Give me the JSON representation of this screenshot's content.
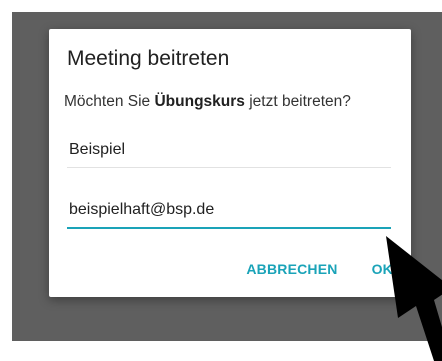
{
  "dialog": {
    "title": "Meeting beitreten",
    "message_prefix": "Möchten Sie ",
    "message_bold": "Übungskurs",
    "message_suffix": " jetzt beitreten?",
    "name_value": "Beispiel",
    "email_value": "beispielhaft@bsp.de",
    "cancel_label": "ABBRECHEN",
    "ok_label": "OK"
  },
  "colors": {
    "accent": "#1aa3b8",
    "scrim": "#5f5f5f"
  },
  "icons": {
    "pointer": "arrow-pointer-icon"
  }
}
